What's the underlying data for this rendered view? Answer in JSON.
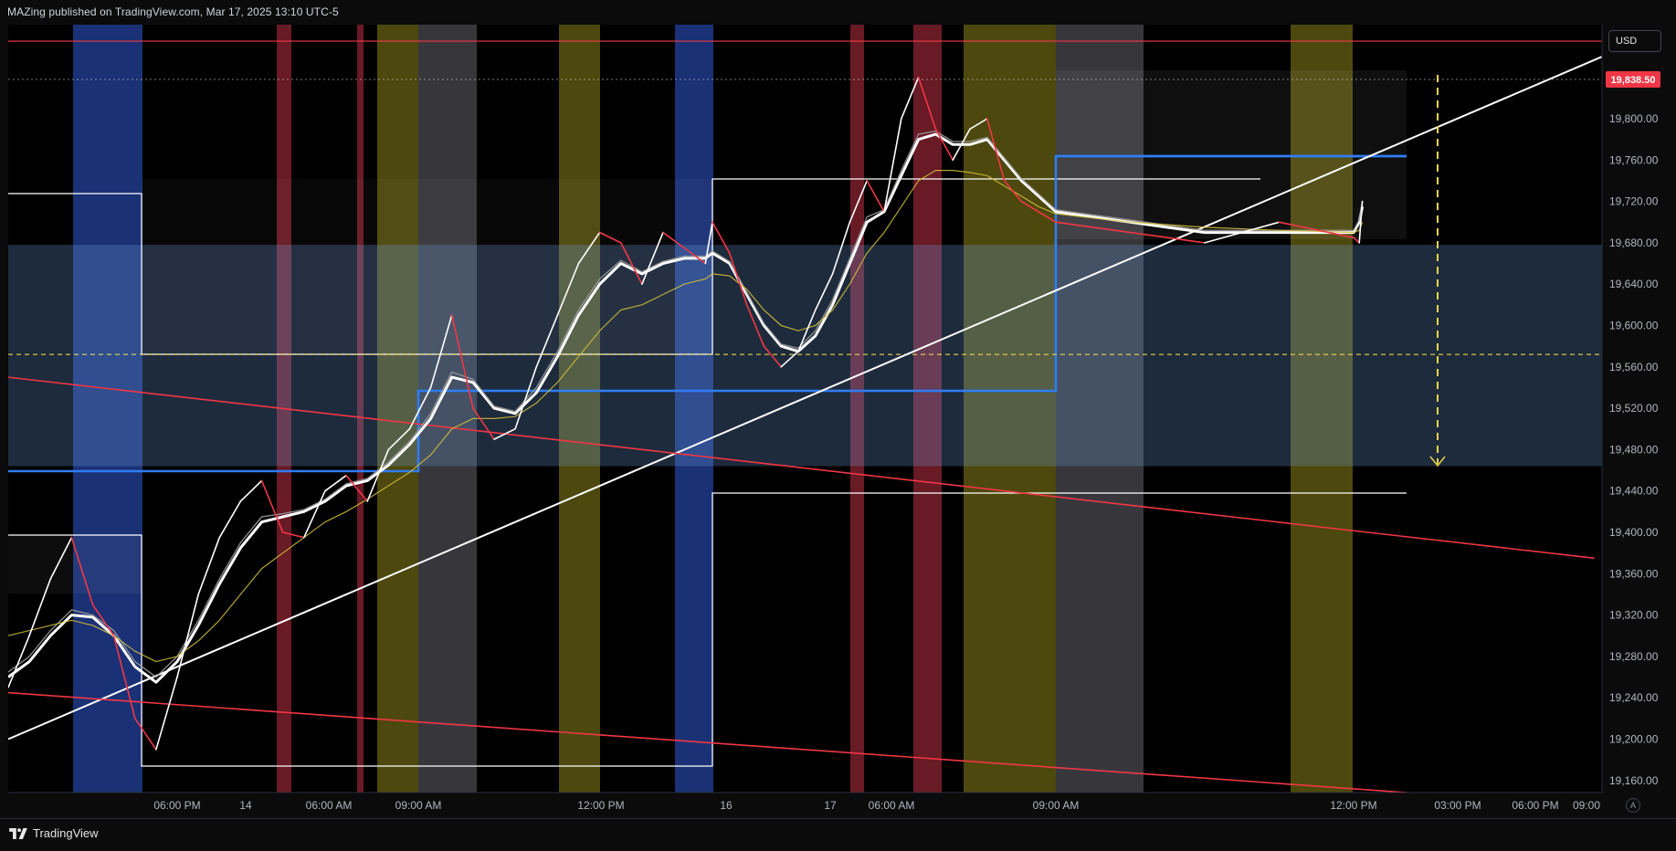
{
  "header": {
    "publish_text": "MAZing published on TradingView.com, Mar 17, 2025 13:10 UTC-5"
  },
  "footer": {
    "brand_text": "TradingView"
  },
  "price_scale": {
    "currency": "USD",
    "auto_label": "A",
    "last_price_label": "19,838.50",
    "last_price_color": "#f23645"
  },
  "colors": {
    "background": "#000000",
    "blue_session": "#1e3a8a",
    "red_session": "#7a1f2b",
    "yellow_session": "#6e6613",
    "gray_session": "#4a4a4f",
    "zone_blue": "#6b9bd6",
    "candle_bull": "#ffffff",
    "candle_bear": "#f23645",
    "ma_fast": "#ffffff",
    "ma_mid": "#9e9e9e",
    "ma_slow": "#d4c13a",
    "range_white": "#ffffff",
    "range_blue": "#2f7df6",
    "trend_red": "#f23645",
    "yellow_dashed": "#e8d44d"
  },
  "chart_data": {
    "type": "line",
    "symbol_currency": "USD",
    "x_tick_labels": [
      "06:00 PM",
      "14",
      "06:00 AM",
      "09:00 AM",
      "12:00 PM",
      "16",
      "17",
      "06:00 AM",
      "09:00 AM",
      "12:00 PM",
      "03:00 PM",
      "06:00 PM",
      "09:00"
    ],
    "y_tick_labels": [
      "19,800.00",
      "19,760.00",
      "19,720.00",
      "19,680.00",
      "19,640.00",
      "19,600.00",
      "19,560.00",
      "19,520.00",
      "19,480.00",
      "19,440.00",
      "19,400.00",
      "19,360.00",
      "19,320.00",
      "19,280.00",
      "19,240.00",
      "19,200.00",
      "19,160.00"
    ],
    "y_ticks": [
      19800,
      19760,
      19720,
      19680,
      19640,
      19600,
      19560,
      19520,
      19480,
      19440,
      19400,
      19360,
      19320,
      19280,
      19240,
      19200,
      19160
    ],
    "ylim": [
      19140,
      19880
    ],
    "last_price": 19838.5,
    "price_series": {
      "name": "",
      "x": [
        "2025-03-13 15:00",
        "2025-03-13 15:45",
        "2025-03-13 16:30",
        "2025-03-13 17:15",
        "2025-03-13 18:00",
        "2025-03-13 18:45",
        "2025-03-13 19:30",
        "2025-03-13 20:15",
        "2025-03-13 21:00",
        "2025-03-13 21:45",
        "2025-03-13 22:30",
        "2025-03-13 23:15",
        "2025-03-14 00:00",
        "2025-03-14 00:45",
        "2025-03-14 01:30",
        "2025-03-14 02:15",
        "2025-03-14 03:00",
        "2025-03-14 03:45",
        "2025-03-14 04:30",
        "2025-03-14 05:15",
        "2025-03-14 06:00",
        "2025-03-14 06:45",
        "2025-03-14 07:30",
        "2025-03-14 08:15",
        "2025-03-14 09:00",
        "2025-03-14 09:45",
        "2025-03-14 10:30",
        "2025-03-14 11:15",
        "2025-03-14 12:00",
        "2025-03-14 12:45",
        "2025-03-14 13:30",
        "2025-03-14 14:15",
        "2025-03-14 15:00",
        "2025-03-14 15:45",
        "2025-03-16 18:00",
        "2025-03-16 18:45",
        "2025-03-16 19:30",
        "2025-03-16 20:15",
        "2025-03-16 21:00",
        "2025-03-16 21:45",
        "2025-03-16 22:30",
        "2025-03-16 23:15",
        "2025-03-17 00:00",
        "2025-03-17 00:45",
        "2025-03-17 01:30",
        "2025-03-17 02:15",
        "2025-03-17 03:00",
        "2025-03-17 03:45",
        "2025-03-17 04:30",
        "2025-03-17 05:15",
        "2025-03-17 06:00",
        "2025-03-17 06:45",
        "2025-03-17 07:30",
        "2025-03-17 08:15",
        "2025-03-17 09:00",
        "2025-03-17 09:45",
        "2025-03-17 10:30",
        "2025-03-17 11:15",
        "2025-03-17 12:00",
        "2025-03-17 12:45",
        "2025-03-17 13:10"
      ],
      "y": [
        19250,
        19300,
        19355,
        19395,
        19330,
        19300,
        19220,
        19190,
        19260,
        19340,
        19395,
        19430,
        19450,
        19400,
        19395,
        19440,
        19455,
        19430,
        19480,
        19500,
        19540,
        19610,
        19520,
        19490,
        19500,
        19560,
        19610,
        19660,
        19690,
        19680,
        19640,
        19690,
        19675,
        19660,
        19700,
        19670,
        19620,
        19580,
        19560,
        19575,
        19615,
        19650,
        19700,
        19740,
        19710,
        19800,
        19840,
        19790,
        19760,
        19790,
        19800,
        19740,
        19720,
        19710,
        19700,
        19690,
        19680,
        19700,
        19685,
        19680,
        19720
      ]
    },
    "moving_averages": [
      {
        "name": "",
        "color": "#ffffff",
        "y": [
          19260,
          19275,
          19300,
          19320,
          19318,
          19300,
          19270,
          19255,
          19275,
          19310,
          19350,
          19385,
          19410,
          19415,
          19420,
          19430,
          19445,
          19450,
          19465,
          19485,
          19510,
          19550,
          19545,
          19520,
          19515,
          19535,
          19570,
          19610,
          19640,
          19660,
          19650,
          19660,
          19665,
          19665,
          19670,
          19660,
          19630,
          19600,
          19580,
          19575,
          19590,
          19620,
          19660,
          19700,
          19710,
          19745,
          19780,
          19785,
          19775,
          19775,
          19780,
          19760,
          19740,
          19725,
          19710,
          19700,
          19690,
          19690,
          19690,
          19700,
          19715
        ]
      },
      {
        "name": "",
        "color": "#9e9e9e",
        "y": [
          19265,
          19280,
          19305,
          19325,
          19320,
          19305,
          19275,
          19260,
          19280,
          19315,
          19355,
          19390,
          19415,
          19418,
          19422,
          19432,
          19447,
          19452,
          19468,
          19488,
          19515,
          19555,
          19548,
          19522,
          19517,
          19540,
          19575,
          19615,
          19645,
          19663,
          19652,
          19662,
          19667,
          19667,
          19672,
          19662,
          19632,
          19602,
          19582,
          19578,
          19595,
          19625,
          19665,
          19705,
          19712,
          19750,
          19785,
          19788,
          19778,
          19778,
          19782,
          19762,
          19742,
          19727,
          19712,
          19702,
          19692,
          19692,
          19692,
          19702,
          19720
        ]
      },
      {
        "name": "",
        "color": "#d4c13a",
        "y": [
          19300,
          19305,
          19310,
          19315,
          19310,
          19300,
          19285,
          19275,
          19280,
          19295,
          19315,
          19340,
          19365,
          19380,
          19395,
          19410,
          19420,
          19432,
          19445,
          19458,
          19475,
          19500,
          19510,
          19510,
          19512,
          19525,
          19545,
          19570,
          19595,
          19615,
          19620,
          19630,
          19640,
          19645,
          19650,
          19648,
          19635,
          19615,
          19600,
          19595,
          19600,
          19615,
          19640,
          19670,
          19690,
          19715,
          19740,
          19750,
          19750,
          19748,
          19745,
          19735,
          19725,
          19715,
          19708,
          19700,
          19695,
          19692,
          19690,
          19692,
          19700
        ]
      }
    ],
    "trendlines": [
      {
        "name": "",
        "color": "#ffffff",
        "x": [
          "2025-03-13 15:00",
          "2025-03-18 21:00"
        ],
        "y": [
          19200,
          19860
        ]
      },
      {
        "name": "",
        "color": "#f23645",
        "x": [
          "2025-03-13 15:00",
          "2025-03-18 20:00"
        ],
        "y": [
          19550,
          19375
        ]
      },
      {
        "name": "",
        "color": "#f23645",
        "x": [
          "2025-03-13 15:00",
          "2025-03-18 11:00"
        ],
        "y": [
          19245,
          19140
        ]
      }
    ],
    "horizontal_levels": [
      {
        "name": "",
        "color": "#f23645",
        "y": 19875
      },
      {
        "name": "",
        "color": "#e8d44d",
        "y": 19572
      }
    ],
    "zones": [
      {
        "name": "",
        "color": "#6b9bd6",
        "y": [
          19464,
          19678
        ]
      }
    ],
    "legend": "none",
    "grid": false
  }
}
